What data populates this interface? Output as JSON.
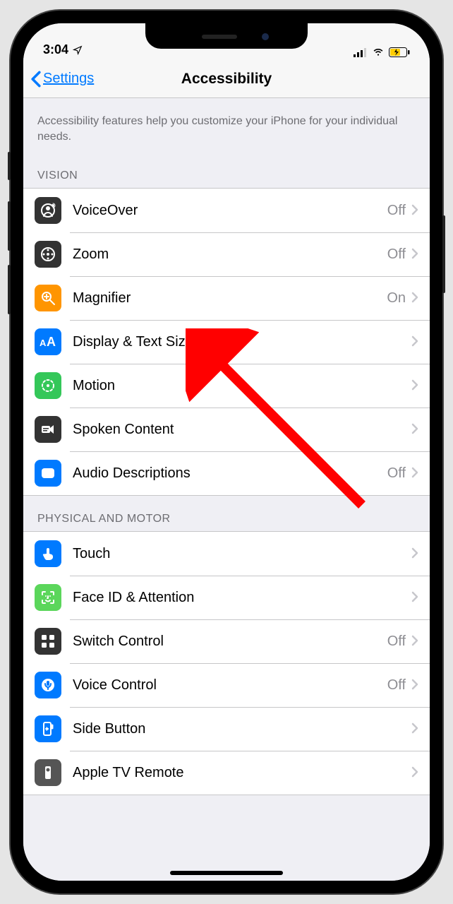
{
  "status": {
    "time": "3:04",
    "location_icon": "location-arrow",
    "signal_icon": "cellular-signal",
    "wifi_icon": "wifi",
    "battery_icon": "battery-charging"
  },
  "nav": {
    "back_label": "Settings",
    "title": "Accessibility"
  },
  "description": "Accessibility features help you customize your iPhone for your individual needs.",
  "sections": [
    {
      "header": "VISION",
      "items": [
        {
          "icon": "voiceover-icon",
          "icon_bg": "bg-dark",
          "label": "VoiceOver",
          "status": "Off"
        },
        {
          "icon": "zoom-icon",
          "icon_bg": "bg-dark",
          "label": "Zoom",
          "status": "Off"
        },
        {
          "icon": "magnifier-icon",
          "icon_bg": "bg-orange",
          "label": "Magnifier",
          "status": "On"
        },
        {
          "icon": "text-size-icon",
          "icon_bg": "bg-blue",
          "label": "Display & Text Size",
          "status": ""
        },
        {
          "icon": "motion-icon",
          "icon_bg": "bg-green",
          "label": "Motion",
          "status": ""
        },
        {
          "icon": "spoken-content-icon",
          "icon_bg": "bg-dark",
          "label": "Spoken Content",
          "status": ""
        },
        {
          "icon": "audio-desc-icon",
          "icon_bg": "bg-blue",
          "label": "Audio Descriptions",
          "status": "Off"
        }
      ]
    },
    {
      "header": "PHYSICAL AND MOTOR",
      "items": [
        {
          "icon": "touch-icon",
          "icon_bg": "bg-blue",
          "label": "Touch",
          "status": ""
        },
        {
          "icon": "faceid-icon",
          "icon_bg": "bg-lightgreen",
          "label": "Face ID & Attention",
          "status": ""
        },
        {
          "icon": "switch-control-icon",
          "icon_bg": "bg-dark",
          "label": "Switch Control",
          "status": "Off"
        },
        {
          "icon": "voice-control-icon",
          "icon_bg": "bg-blue",
          "label": "Voice Control",
          "status": "Off"
        },
        {
          "icon": "side-button-icon",
          "icon_bg": "bg-blue",
          "label": "Side Button",
          "status": ""
        },
        {
          "icon": "tv-remote-icon",
          "icon_bg": "bg-gray",
          "label": "Apple TV Remote",
          "status": ""
        }
      ]
    }
  ],
  "annotation": {
    "type": "arrow",
    "color": "#ff0000",
    "points_to": "Display & Text Size"
  }
}
